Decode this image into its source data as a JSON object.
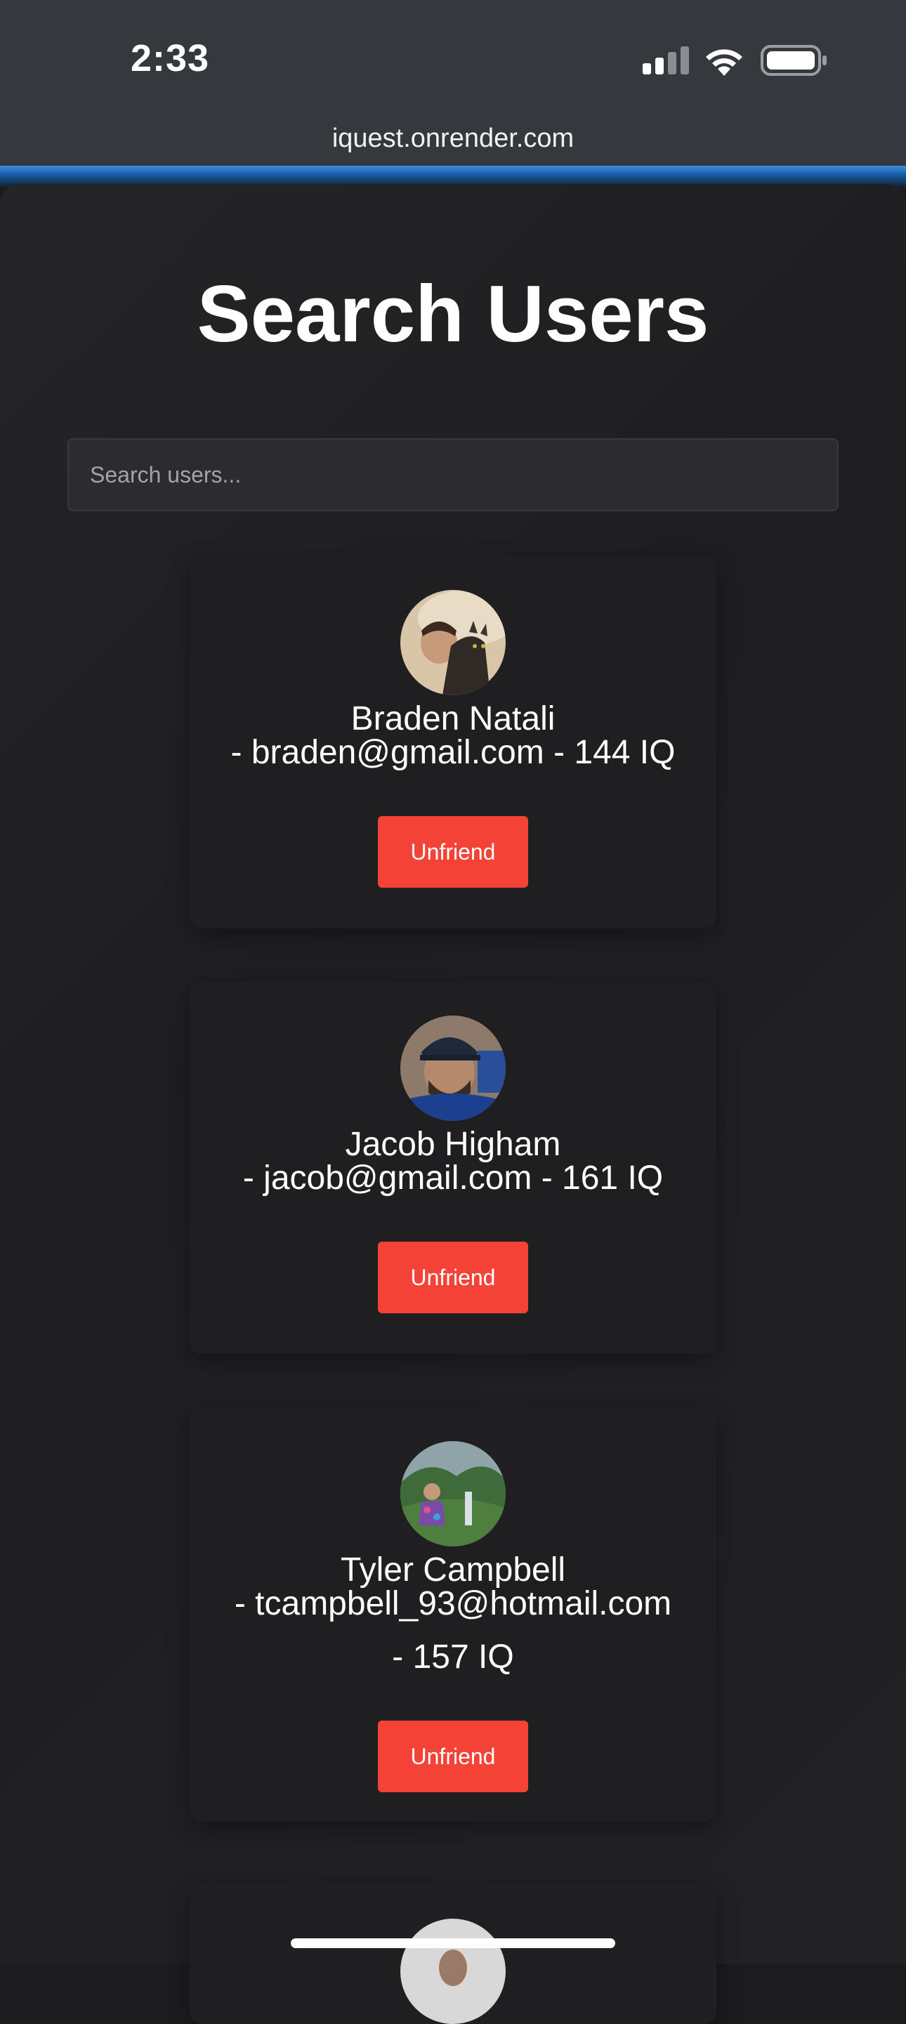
{
  "status_bar": {
    "time": "2:33"
  },
  "browser": {
    "url": "iquest.onrender.com"
  },
  "page": {
    "title": "Search Users"
  },
  "search": {
    "placeholder": "Search users..."
  },
  "users": [
    {
      "name": "Braden Natali",
      "meta": "- braden@gmail.com - 144 IQ",
      "action": "Unfriend"
    },
    {
      "name": "Jacob Higham",
      "meta": "- jacob@gmail.com - 161 IQ",
      "action": "Unfriend"
    },
    {
      "name": "Tyler Campbell",
      "meta_line1": "- tcampbell_93@hotmail.com",
      "meta_line2": "- 157 IQ",
      "action": "Unfriend"
    }
  ],
  "colors": {
    "accent": "#f44336",
    "background": "#1c1c1e",
    "card": "#1f1f21"
  }
}
